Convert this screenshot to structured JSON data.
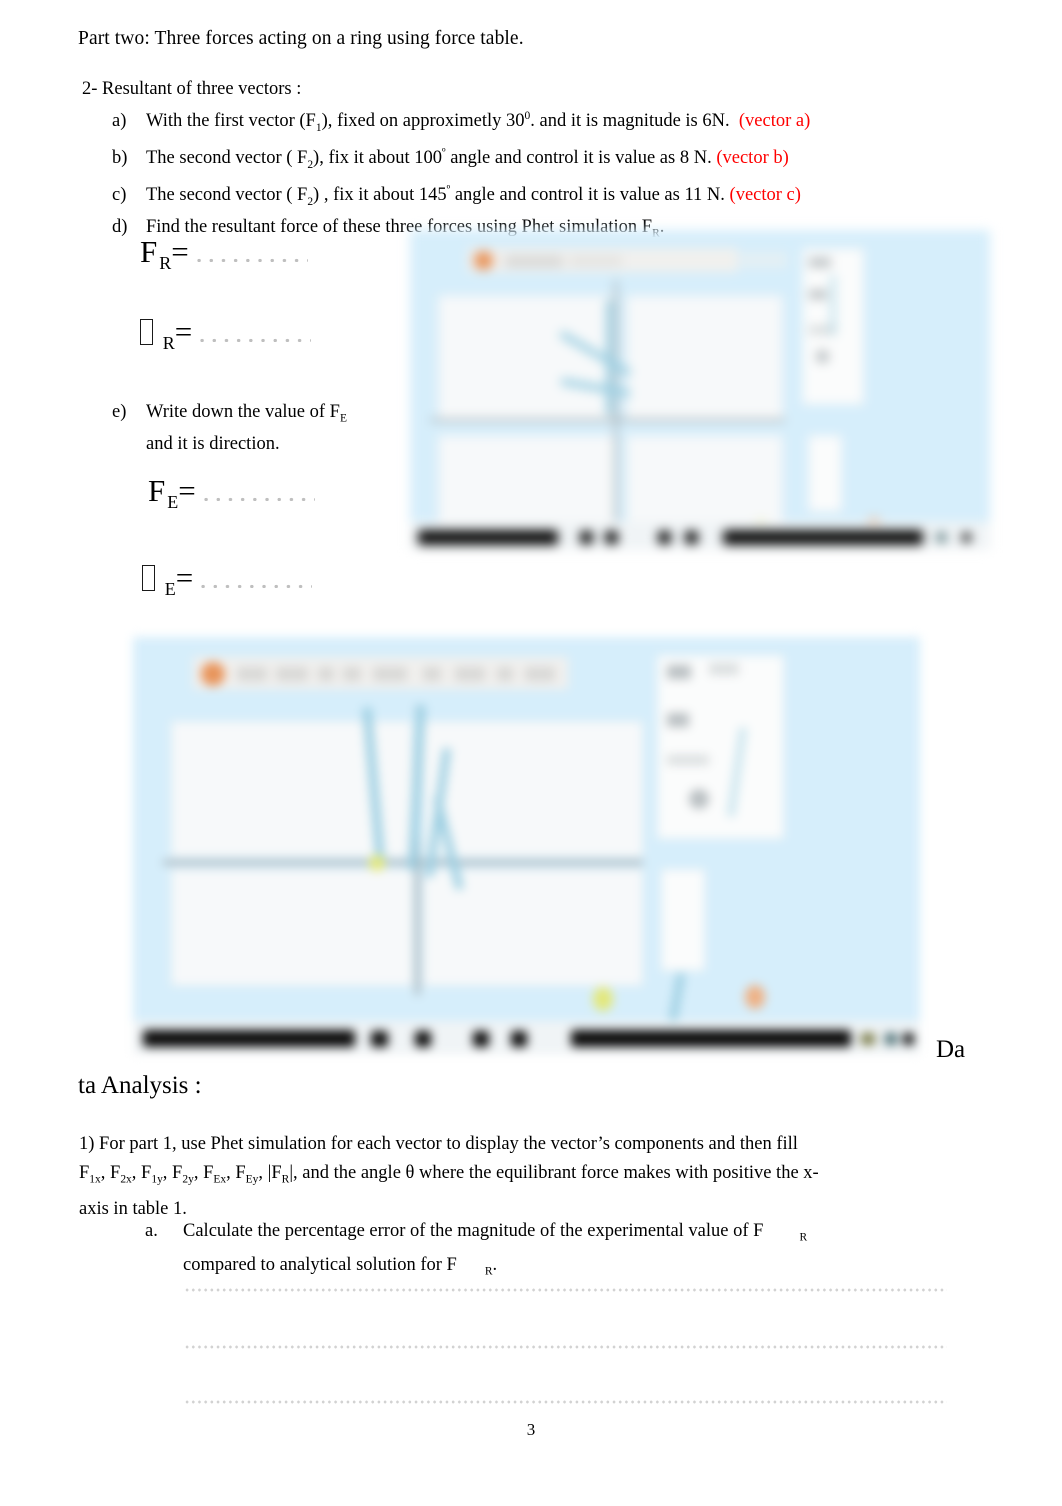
{
  "document": {
    "title_line": "Part two:  Three forces acting on a ring using force table.",
    "section_line": "2- Resultant of three    vectors :",
    "page_number": "3"
  },
  "vector_list": [
    {
      "marker": "a)",
      "text_before": "With the first vector (F",
      "sub1": "1",
      "text_mid": "), fixed on approximetly 30",
      "sup": "0",
      "text_after": ". and it is magnitude is 6N.",
      "tag": "(vector a)"
    },
    {
      "marker": "b)",
      "text_before": "The second vector ( F",
      "sub1": "2",
      "text_mid": "), fix it about   100",
      "sup": "º",
      "text_after": " angle and  control it is value as 8 N.",
      "tag": "(vector b)"
    },
    {
      "marker": "c)",
      "text_before": "The second vector ( F",
      "sub1": "2",
      "text_mid": ") , fix it about  145",
      "sup": "º",
      "text_after": " angle and  control it is value as 11 N.",
      "tag": "(vector c)"
    },
    {
      "marker": "d)",
      "text_before": "Find the resultant force of these three forces using Phet simulation F",
      "sub1": "R",
      "text_mid": ".",
      "sup": "",
      "text_after": "",
      "tag": ""
    }
  ],
  "answer_blanks": {
    "fr_symbol": "F",
    "fr_sub": "R",
    "fr_equals": "=",
    "theta_r_sub": "R",
    "theta_r_equals": "=",
    "fe_symbol": "F",
    "fe_sub": "E",
    "fe_equals": "=",
    "theta_e_sub": "E",
    "theta_e_equals": "="
  },
  "item_e": {
    "marker": "e)",
    "line1_before": "Write down the value of F",
    "line1_sub": "E",
    "line2": "and it is direction."
  },
  "data_analysis": {
    "heading_part1": "Da",
    "heading_part2": "ta Analysis :"
  },
  "paragraph_1": {
    "line1": "1) For part 1, use Phet simulation for each vector to display the vector’s components and then fill",
    "line2_tokens": [
      {
        "base": "F",
        "sub": "1x",
        "tail": ", "
      },
      {
        "base": "F",
        "sub": "2x",
        "tail": ", "
      },
      {
        "base": "F",
        "sub": "1y",
        "tail": ", "
      },
      {
        "base": "F",
        "sub": "2y",
        "tail": ", "
      },
      {
        "base": "F",
        "sub": "Ex",
        "tail": ", "
      },
      {
        "base": "F",
        "sub": "Ey",
        "tail": ", |"
      },
      {
        "base": "F",
        "sub": "R",
        "tail": "|, and the angle θ where the equilibrant force makes with positive the x-"
      }
    ],
    "line3": "axis in table 1."
  },
  "item_a": {
    "marker": "a.",
    "line1": "Calculate the percentage error of the magnitude of the experimental value of F",
    "line1_sub": "R",
    "line2": "compared to analytical solution for F",
    "line2_sub": "R",
    "line2_tail": "."
  },
  "screenshots": [
    {
      "name": "phet-vector-addition-screenshot-1",
      "background_color": "#d6eefb",
      "taskbar_color": "#0b0b0b",
      "accent_color": "#e8945a"
    },
    {
      "name": "phet-vector-addition-screenshot-2",
      "background_color": "#d6eefb",
      "taskbar_color": "#0b0b0b",
      "accent_color": "#e8945a"
    }
  ],
  "dotted_answer_lines": 3
}
